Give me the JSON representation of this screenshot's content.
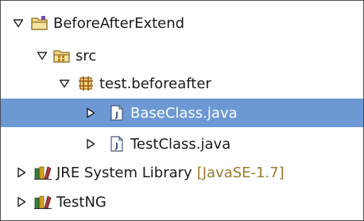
{
  "tree": {
    "items": [
      {
        "label": "BeforeAfterExtend",
        "expanded": true,
        "icon": "project-folder-icon"
      },
      {
        "label": "src",
        "expanded": true,
        "icon": "source-folder-icon"
      },
      {
        "label": "test.beforeafter",
        "expanded": true,
        "icon": "package-icon"
      },
      {
        "label": "BaseClass.java",
        "expanded": false,
        "selected": true,
        "icon": "java-file-icon"
      },
      {
        "label": "TestClass.java",
        "expanded": false,
        "icon": "java-file-icon"
      },
      {
        "label": "JRE System Library",
        "decoration": "[JavaSE-1.7]",
        "expanded": false,
        "icon": "library-icon"
      },
      {
        "label": "TestNG",
        "expanded": false,
        "icon": "library-icon"
      }
    ]
  },
  "colors": {
    "selection": "#6c98d4",
    "decoration_text": "#9b7a30"
  }
}
